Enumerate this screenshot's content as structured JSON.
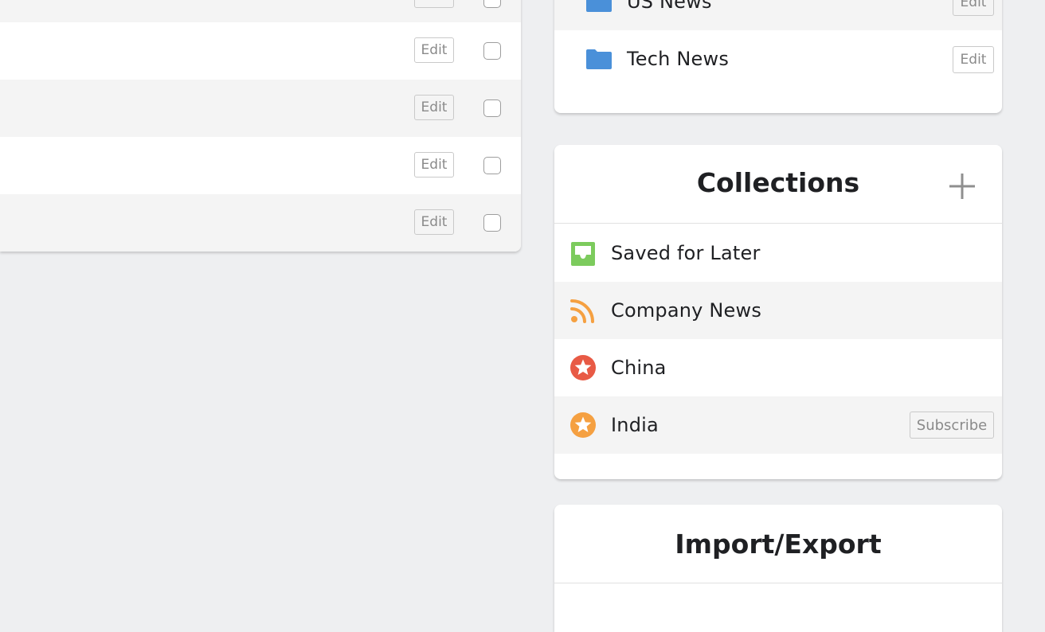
{
  "feeds": {
    "rows": [
      {
        "edit_label": "Edit",
        "checked": false
      },
      {
        "edit_label": "Edit",
        "checked": false
      },
      {
        "edit_label": "Edit",
        "checked": false
      },
      {
        "edit_label": "Edit",
        "checked": false
      },
      {
        "edit_label": "Edit",
        "checked": false
      }
    ]
  },
  "folders": {
    "items": [
      {
        "label": "US News",
        "edit_label": "Edit",
        "icon": "folder-icon",
        "color": "#4a90d9"
      },
      {
        "label": "Tech News",
        "edit_label": "Edit",
        "icon": "folder-icon",
        "color": "#4a90d9"
      }
    ]
  },
  "collections": {
    "title": "Collections",
    "add_icon": "plus-icon",
    "items": [
      {
        "label": "Saved for Later",
        "icon": "inbox-icon",
        "color": "#7ccb5d"
      },
      {
        "label": "Company News",
        "icon": "rss-icon",
        "color": "#f5a041"
      },
      {
        "label": "China",
        "icon": "star-badge-icon",
        "color": "#e85a45"
      },
      {
        "label": "India",
        "icon": "star-badge-icon",
        "color": "#f5a041",
        "subscribe_label": "Subscribe"
      }
    ]
  },
  "import_export": {
    "title": "Import/Export"
  }
}
